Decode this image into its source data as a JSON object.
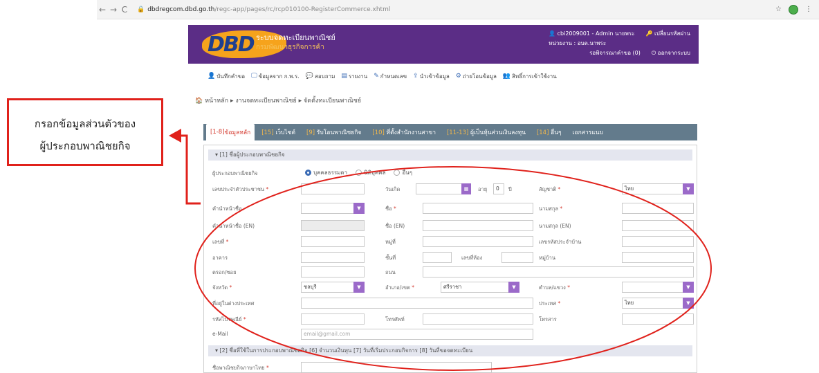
{
  "browser": {
    "url_host": "dbdregcom.dbd.go.th",
    "url_path": "/regc-app/pages/rc/rcp010100-RegisterCommerce.xhtml"
  },
  "header": {
    "logo": "DBD",
    "title": "ระบบจดทะเบียนพาณิชย์",
    "subtitle": "กรมพัฒนาธุรกิจการค้า",
    "user_line": "cbi2009001 - Admin นายพระ",
    "change_password": "เปลี่ยนรหัสผ่าน",
    "agency": "หน่วยงาน : อบต.นาพระ",
    "pending": "รอพิจารณาคำขอ (0)",
    "logout": "ออกจากระบบ"
  },
  "top_menu": [
    {
      "icon": "user-icon",
      "glyph": "👤",
      "label": "บันทึกคำขอ"
    },
    {
      "icon": "monitor-icon",
      "glyph": "🖵",
      "label": "ข้อมูลจาก ก.พ.ร."
    },
    {
      "icon": "chat-icon",
      "glyph": "💬",
      "label": "สอบถาม"
    },
    {
      "icon": "report-icon",
      "glyph": "▤",
      "label": "รายงาน"
    },
    {
      "icon": "edit-icon",
      "glyph": "✎",
      "label": "กำหนดเลข"
    },
    {
      "icon": "import-icon",
      "glyph": "⇪",
      "label": "นำเข้าข้อมูล"
    },
    {
      "icon": "gear-icon",
      "glyph": "⚙",
      "label": "ถ่ายโอนข้อมูล"
    },
    {
      "icon": "users-icon",
      "glyph": "👥",
      "label": "สิทธิ์การเข้าใช้งาน"
    }
  ],
  "breadcrumb": "🏠 หน้าหลัก ▸ งานจดทะเบียนพาณิชย์ ▸ จัดตั้งทะเบียนพาณิชย์",
  "tabs": [
    {
      "num": "[1-8]",
      "label": "ข้อมูลหลัก"
    },
    {
      "num": "[15]",
      "label": "เว็บไซต์"
    },
    {
      "num": "[9]",
      "label": "รับโอนพาณิชยกิจ"
    },
    {
      "num": "[10]",
      "label": "ที่ตั้งสำนักงานสาขา"
    },
    {
      "num": "[11-13]",
      "label": "ผู้เป็นหุ้นส่วนเงินลงทุน"
    },
    {
      "num": "[14]",
      "label": "อื่นๆ"
    },
    {
      "num": "",
      "label": "เอกสารแนบ"
    }
  ],
  "section1": "▾  [1] ชื่อผู้ประกอบพาณิชยกิจ",
  "section2": "▾  [2] ชื่อที่ใช้ในการประกอบพาณิชยกิจ [6] จำนวนเงินทุน [7] วันที่เริ่มประกอบกิจการ [8] วันที่ขอจดทะเบียน",
  "form": {
    "type_label": "ผู้ประกอบพาณิชยกิจ",
    "radio_person": "บุคคลธรรมดา",
    "radio_juristic": "นิติบุคคล",
    "radio_other": "อื่นๆ",
    "id_label": "เลขประจำตัวประชาชน",
    "birth_label": "วันเกิด",
    "age_label": "อายุ",
    "age_value": "0",
    "age_unit": "ปี",
    "nationality_label": "สัญชาติ",
    "nationality_value": "ไทย",
    "prefix_label": "คำนำหน้าชื่อ",
    "fname_label": "ชื่อ",
    "lname_label": "นามสกุล",
    "prefix_en_label": "คำนำหน้าชื่อ (EN)",
    "fname_en_label": "ชื่อ (EN)",
    "lname_en_label": "นามสกุล (EN)",
    "house_no_label": "เลขที่",
    "moo_label": "หมู่ที่",
    "house_code_label": "เลขรหัสประจำบ้าน",
    "building_label": "อาคาร",
    "floor_label": "ชั้นที่",
    "room_label": "เลขที่ห้อง",
    "village_label": "หมู่บ้าน",
    "soi_label": "ตรอก/ซอย",
    "road_label": "ถนน",
    "province_label": "จังหวัด",
    "province_value": "ชลบุรี",
    "district_label": "อำเภอ/เขต",
    "district_value": "ศรีราชา",
    "subdistrict_label": "ตำบล/แขวง",
    "abroad_label": "ที่อยู่ในต่างประเทศ",
    "country_label": "ประเทศ",
    "country_value": "ไทย",
    "zip_label": "รหัสไปรษณีย์",
    "phone_label": "โทรศัพท์",
    "fax_label": "โทรสาร",
    "email_label": "e-Mail",
    "email_placeholder": "email@gmail.com",
    "trade_name_label": "ชื่อพาณิชยกิจภาษาไทย"
  },
  "annotation": {
    "line1": "กรอกข้อมูลส่วนตัวของ",
    "line2": "ผู้ประกอบพาณิชยกิจ",
    "color": "#e0211b"
  },
  "colors": {
    "header_purple": "#5b2d86",
    "tab_bar": "#637b8c",
    "dropdown_purple": "#9b6ac9"
  }
}
